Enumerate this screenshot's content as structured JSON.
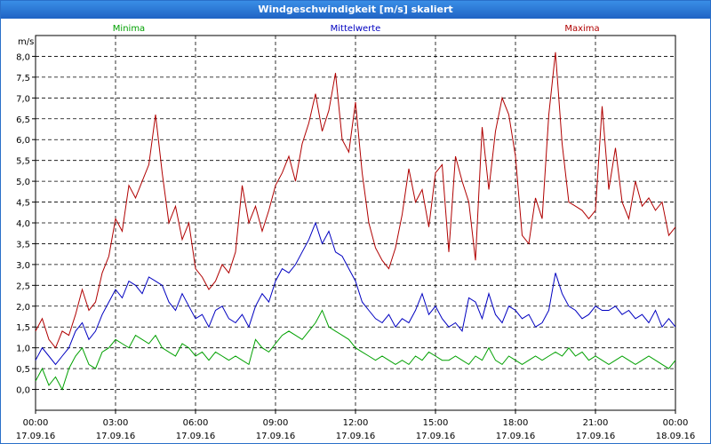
{
  "window": {
    "title": "Windgeschwindigkeit [m/s] skaliert"
  },
  "chart_data": {
    "type": "line",
    "title": "Windgeschwindigkeit [m/s] skaliert",
    "ylabel": "m/s",
    "xlabel": "",
    "ylim": [
      -0.5,
      8.5
    ],
    "xlim": [
      0,
      24
    ],
    "yticks": [
      "0,0",
      "0,5",
      "1,0",
      "1,5",
      "2,0",
      "2,5",
      "3,0",
      "3,5",
      "4,0",
      "4,5",
      "5,0",
      "5,5",
      "6,0",
      "6,5",
      "7,0",
      "7,5",
      "8,0"
    ],
    "ytick_values": [
      0,
      0.5,
      1,
      1.5,
      2,
      2.5,
      3,
      3.5,
      4,
      4.5,
      5,
      5.5,
      6,
      6.5,
      7,
      7.5,
      8
    ],
    "xticks": [
      {
        "time": "00:00",
        "date": "17.09.16"
      },
      {
        "time": "03:00",
        "date": "17.09.16"
      },
      {
        "time": "06:00",
        "date": "17.09.16"
      },
      {
        "time": "09:00",
        "date": "17.09.16"
      },
      {
        "time": "12:00",
        "date": "17.09.16"
      },
      {
        "time": "15:00",
        "date": "17.09.16"
      },
      {
        "time": "18:00",
        "date": "17.09.16"
      },
      {
        "time": "21:00",
        "date": "17.09.16"
      },
      {
        "time": "00:00",
        "date": "18.09.16"
      }
    ],
    "xtick_hours": [
      0,
      3,
      6,
      9,
      12,
      15,
      18,
      21,
      24
    ],
    "grid": true,
    "legend_position": "top",
    "series": [
      {
        "name": "Minima",
        "color": "#00a000",
        "x": [
          0,
          0.25,
          0.5,
          0.75,
          1,
          1.25,
          1.5,
          1.75,
          2,
          2.25,
          2.5,
          2.75,
          3,
          3.25,
          3.5,
          3.75,
          4,
          4.25,
          4.5,
          4.75,
          5,
          5.25,
          5.5,
          5.75,
          6,
          6.25,
          6.5,
          6.75,
          7,
          7.25,
          7.5,
          7.75,
          8,
          8.25,
          8.5,
          8.75,
          9,
          9.25,
          9.5,
          9.75,
          10,
          10.25,
          10.5,
          10.75,
          11,
          11.25,
          11.5,
          11.75,
          12,
          12.25,
          12.5,
          12.75,
          13,
          13.25,
          13.5,
          13.75,
          14,
          14.25,
          14.5,
          14.75,
          15,
          15.25,
          15.5,
          15.75,
          16,
          16.25,
          16.5,
          16.75,
          17,
          17.25,
          17.5,
          17.75,
          18,
          18.25,
          18.5,
          18.75,
          19,
          19.25,
          19.5,
          19.75,
          20,
          20.25,
          20.5,
          20.75,
          21,
          21.25,
          21.5,
          21.75,
          22,
          22.25,
          22.5,
          22.75,
          23,
          23.25,
          23.5,
          23.75,
          24
        ],
        "values": [
          0.2,
          0.5,
          0.1,
          0.3,
          0.0,
          0.5,
          0.8,
          1.0,
          0.6,
          0.5,
          0.9,
          1.0,
          1.2,
          1.1,
          1.0,
          1.3,
          1.2,
          1.1,
          1.3,
          1.0,
          0.9,
          0.8,
          1.1,
          1.0,
          0.8,
          0.9,
          0.7,
          0.9,
          0.8,
          0.7,
          0.8,
          0.7,
          0.6,
          1.2,
          1.0,
          0.9,
          1.1,
          1.3,
          1.4,
          1.3,
          1.2,
          1.4,
          1.6,
          1.9,
          1.5,
          1.4,
          1.3,
          1.2,
          1.0,
          0.9,
          0.8,
          0.7,
          0.8,
          0.7,
          0.6,
          0.7,
          0.6,
          0.8,
          0.7,
          0.9,
          0.8,
          0.7,
          0.7,
          0.8,
          0.7,
          0.6,
          0.8,
          0.7,
          1.0,
          0.7,
          0.6,
          0.8,
          0.7,
          0.6,
          0.7,
          0.8,
          0.7,
          0.8,
          0.9,
          0.8,
          1.0,
          0.8,
          0.9,
          0.7,
          0.8,
          0.7,
          0.6,
          0.7,
          0.8,
          0.7,
          0.6,
          0.7,
          0.8,
          0.7,
          0.6,
          0.5,
          0.7
        ],
        "label_hour": 3.5
      },
      {
        "name": "Mittelwerte",
        "color": "#0000c0",
        "x": [
          0,
          0.25,
          0.5,
          0.75,
          1,
          1.25,
          1.5,
          1.75,
          2,
          2.25,
          2.5,
          2.75,
          3,
          3.25,
          3.5,
          3.75,
          4,
          4.25,
          4.5,
          4.75,
          5,
          5.25,
          5.5,
          5.75,
          6,
          6.25,
          6.5,
          6.75,
          7,
          7.25,
          7.5,
          7.75,
          8,
          8.25,
          8.5,
          8.75,
          9,
          9.25,
          9.5,
          9.75,
          10,
          10.25,
          10.5,
          10.75,
          11,
          11.25,
          11.5,
          11.75,
          12,
          12.25,
          12.5,
          12.75,
          13,
          13.25,
          13.5,
          13.75,
          14,
          14.25,
          14.5,
          14.75,
          15,
          15.25,
          15.5,
          15.75,
          16,
          16.25,
          16.5,
          16.75,
          17,
          17.25,
          17.5,
          17.75,
          18,
          18.25,
          18.5,
          18.75,
          19,
          19.25,
          19.5,
          19.75,
          20,
          20.25,
          20.5,
          20.75,
          21,
          21.25,
          21.5,
          21.75,
          22,
          22.25,
          22.5,
          22.75,
          23,
          23.25,
          23.5,
          23.75,
          24
        ],
        "values": [
          0.7,
          1.0,
          0.8,
          0.6,
          0.8,
          1.0,
          1.4,
          1.6,
          1.2,
          1.4,
          1.8,
          2.1,
          2.4,
          2.2,
          2.6,
          2.5,
          2.3,
          2.7,
          2.6,
          2.5,
          2.1,
          1.9,
          2.3,
          2.0,
          1.7,
          1.8,
          1.5,
          1.9,
          2.0,
          1.7,
          1.6,
          1.8,
          1.5,
          2.0,
          2.3,
          2.1,
          2.6,
          2.9,
          2.8,
          3.0,
          3.3,
          3.6,
          4.0,
          3.5,
          3.8,
          3.3,
          3.2,
          2.9,
          2.6,
          2.1,
          1.9,
          1.7,
          1.6,
          1.8,
          1.5,
          1.7,
          1.6,
          1.9,
          2.3,
          1.8,
          2.0,
          1.7,
          1.5,
          1.6,
          1.4,
          2.2,
          2.1,
          1.7,
          2.3,
          1.8,
          1.6,
          2.0,
          1.9,
          1.7,
          1.8,
          1.5,
          1.6,
          1.9,
          2.8,
          2.3,
          2.0,
          1.9,
          1.7,
          1.8,
          2.0,
          1.9,
          1.9,
          2.0,
          1.8,
          1.9,
          1.7,
          1.8,
          1.6,
          1.9,
          1.5,
          1.7,
          1.5
        ],
        "label_hour": 12
      },
      {
        "name": "Maxima",
        "color": "#b00000",
        "x": [
          0,
          0.25,
          0.5,
          0.75,
          1,
          1.25,
          1.5,
          1.75,
          2,
          2.25,
          2.5,
          2.75,
          3,
          3.25,
          3.5,
          3.75,
          4,
          4.25,
          4.5,
          4.75,
          5,
          5.25,
          5.5,
          5.75,
          6,
          6.25,
          6.5,
          6.75,
          7,
          7.25,
          7.5,
          7.75,
          8,
          8.25,
          8.5,
          8.75,
          9,
          9.25,
          9.5,
          9.75,
          10,
          10.25,
          10.5,
          10.75,
          11,
          11.25,
          11.5,
          11.75,
          12,
          12.25,
          12.5,
          12.75,
          13,
          13.25,
          13.5,
          13.75,
          14,
          14.25,
          14.5,
          14.75,
          15,
          15.25,
          15.5,
          15.75,
          16,
          16.25,
          16.5,
          16.75,
          17,
          17.25,
          17.5,
          17.75,
          18,
          18.25,
          18.5,
          18.75,
          19,
          19.25,
          19.5,
          19.75,
          20,
          20.25,
          20.5,
          20.75,
          21,
          21.25,
          21.5,
          21.75,
          22,
          22.25,
          22.5,
          22.75,
          23,
          23.25,
          23.5,
          23.75,
          24
        ],
        "values": [
          1.4,
          1.7,
          1.2,
          1.0,
          1.4,
          1.3,
          1.8,
          2.4,
          1.9,
          2.1,
          2.8,
          3.2,
          4.1,
          3.8,
          4.9,
          4.6,
          5.0,
          5.4,
          6.6,
          5.2,
          4.0,
          4.4,
          3.6,
          4.0,
          2.9,
          2.7,
          2.4,
          2.6,
          3.0,
          2.8,
          3.3,
          4.9,
          4.0,
          4.4,
          3.8,
          4.3,
          4.9,
          5.2,
          5.6,
          5.0,
          5.9,
          6.4,
          7.1,
          6.2,
          6.7,
          7.6,
          6.0,
          5.7,
          6.9,
          5.2,
          4.0,
          3.4,
          3.1,
          2.9,
          3.4,
          4.2,
          5.3,
          4.5,
          4.8,
          3.9,
          5.2,
          5.4,
          3.3,
          5.6,
          5.0,
          4.5,
          3.1,
          6.3,
          4.8,
          6.2,
          7.0,
          6.6,
          5.6,
          3.7,
          3.5,
          4.6,
          4.1,
          6.6,
          8.1,
          5.9,
          4.5,
          4.4,
          4.3,
          4.1,
          4.3,
          6.8,
          4.8,
          5.8,
          4.5,
          4.1,
          5.0,
          4.4,
          4.6,
          4.3,
          4.5,
          3.7,
          3.9
        ],
        "label_hour": 20.5
      }
    ]
  }
}
